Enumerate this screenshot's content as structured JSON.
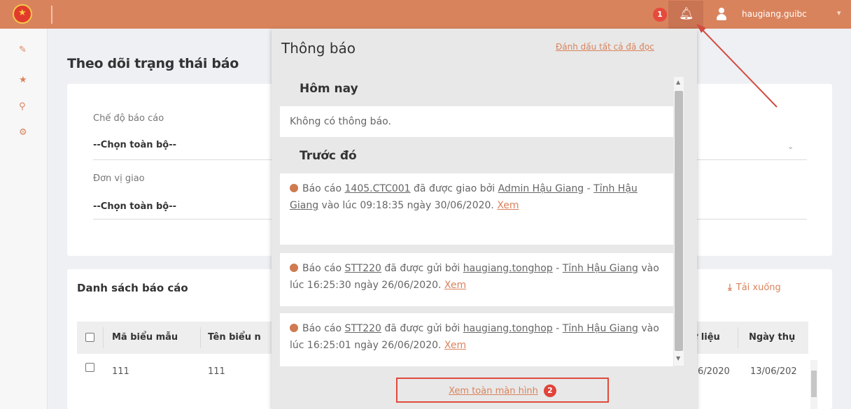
{
  "topbar": {
    "notification_count": "1",
    "username": "haugiang.guibc"
  },
  "sidebar": {
    "icons": [
      "pencil-icon",
      "star-icon",
      "search-icon",
      "settings-icon"
    ]
  },
  "main": {
    "page_title": "Theo dõi trạng thái báo",
    "filters": {
      "mode_label": "Chế độ báo cáo",
      "mode_value": "--Chọn toàn bộ--",
      "unit_label": "Đơn vị giao",
      "unit_value": "--Chọn toàn bộ--"
    },
    "list_title": "Danh sách báo cáo",
    "download_label": "Tải xuống",
    "table": {
      "columns": [
        "Mã biểu mẫu",
        "Tên biểu n",
        "ữ liệu",
        "Ngày thụ"
      ],
      "rows": [
        {
          "code": "111",
          "name": "111",
          "data_date": "6/2020",
          "received": "13/06/202"
        }
      ]
    }
  },
  "notifications": {
    "title": "Thông báo",
    "mark_all_read": "Đánh dấu tất cả đã đọc",
    "today_heading": "Hôm nay",
    "empty_text": "Không có thông báo.",
    "earlier_heading": "Trước đó",
    "items": [
      {
        "prefix": "Báo cáo",
        "code": "1405.CTC001",
        "action": "đã được giao bởi",
        "actor": "Admin Hậu Giang",
        "sep": "-",
        "province": "Tỉnh Hậu Giang",
        "time_text": "vào lúc 09:18:35 ngày 30/06/2020.",
        "link": "Xem"
      },
      {
        "prefix": "Báo cáo",
        "code": "STT220",
        "action": "đã được gửi bởi",
        "actor": "haugiang.tonghop",
        "sep": "-",
        "province": "Tỉnh Hậu Giang",
        "time_text": "vào lúc 16:25:30 ngày 26/06/2020.",
        "link": "Xem"
      },
      {
        "prefix": "Báo cáo",
        "code": "STT220",
        "action": "đã được gửi bởi",
        "actor": "haugiang.tonghop",
        "sep": "-",
        "province": "Tỉnh Hậu Giang",
        "time_text": "vào lúc 16:25:01 ngày 26/06/2020.",
        "link": "Xem"
      }
    ],
    "fullscreen_link": "Xem toàn màn hình",
    "step_badge": "2"
  },
  "colors": {
    "accent": "#d9835d",
    "highlight_red": "#e04a3a"
  }
}
